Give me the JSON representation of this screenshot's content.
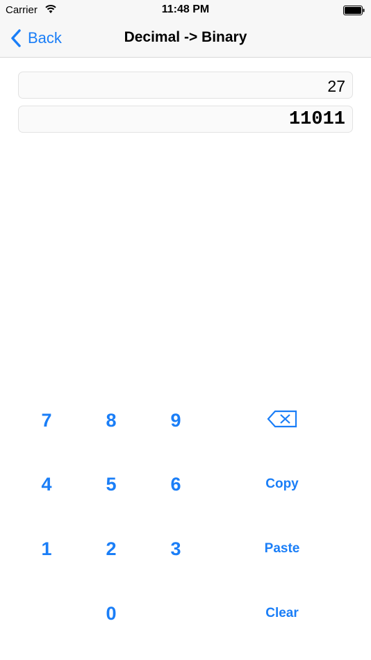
{
  "status_bar": {
    "carrier": "Carrier",
    "time": "11:48 PM"
  },
  "nav": {
    "back_label": "Back",
    "title": "Decimal -> Binary"
  },
  "fields": {
    "input_value": "27",
    "output_value": "11011"
  },
  "keypad": {
    "rows": [
      [
        "7",
        "8",
        "9"
      ],
      [
        "4",
        "5",
        "6"
      ],
      [
        "1",
        "2",
        "3"
      ],
      [
        "",
        "0",
        ""
      ]
    ],
    "actions": {
      "copy": "Copy",
      "paste": "Paste",
      "clear": "Clear"
    },
    "backspace_icon": "backspace-icon"
  },
  "colors": {
    "accent": "#1a7ef7",
    "bar_bg": "#f7f7f7"
  }
}
